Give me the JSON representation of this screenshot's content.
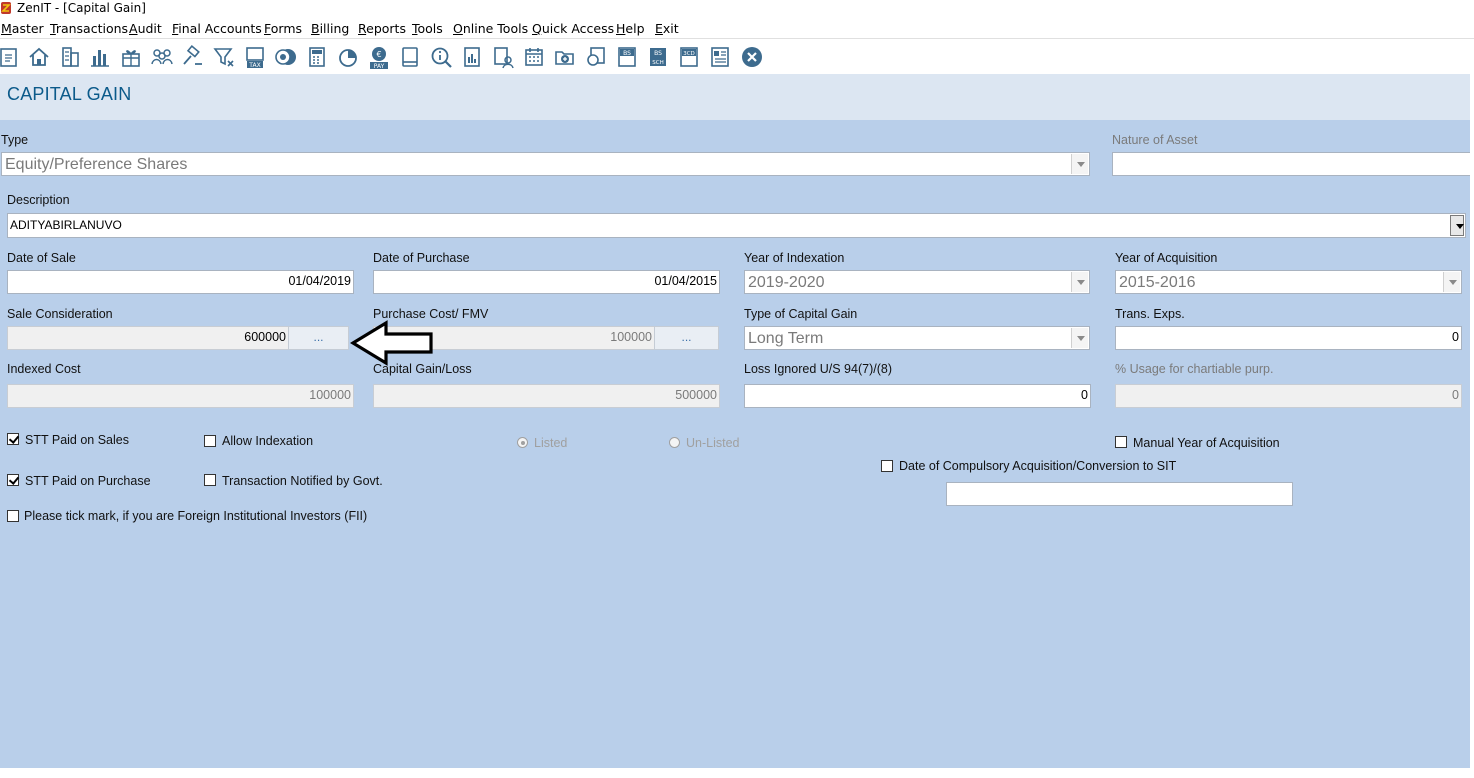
{
  "window": {
    "title": "ZenIT - [Capital Gain]"
  },
  "menu": [
    {
      "label": "Master",
      "key": "M",
      "rest": "aster"
    },
    {
      "label": "Transactions",
      "key": "T",
      "rest": "ransactions"
    },
    {
      "label": "Audit",
      "key": "A",
      "rest": "udit"
    },
    {
      "label": "Final Accounts",
      "key": "F",
      "rest": "inal Accounts"
    },
    {
      "label": "Forms",
      "key": "F",
      "rest": "orms"
    },
    {
      "label": "Billing",
      "key": "B",
      "rest": "illing"
    },
    {
      "label": "Reports",
      "key": "R",
      "rest": "eports"
    },
    {
      "label": "Tools",
      "key": "T",
      "rest": "ools"
    },
    {
      "label": "Online Tools",
      "key": "O",
      "rest": "nline Tools"
    },
    {
      "label": "Quick Access",
      "key": "Q",
      "rest": "uick Access"
    },
    {
      "label": "Help",
      "key": "H",
      "rest": "elp"
    },
    {
      "label": "Exit",
      "key": "E",
      "rest": "xit"
    }
  ],
  "toolbar_icons": [
    "refresh-icon",
    "home-icon",
    "building-icon",
    "bar-chart-icon",
    "gift-icon",
    "group-icon",
    "gavel-icon",
    "filter-icon",
    "tax-icon",
    "coins-icon",
    "calculator-icon",
    "pie-chart-icon",
    "pay-icon",
    "book-icon",
    "search-info-icon",
    "report-icon",
    "user-report-icon",
    "calendar-icon",
    "add-folder-icon",
    "copy-search-icon",
    "bs-icon",
    "bs-sch-icon",
    "3cd-icon",
    "form-icon",
    "close-circle-icon"
  ],
  "toolbar_text": {
    "tax": "TAX",
    "pay": "PAY",
    "bs": "BS",
    "bs2": "BS",
    "sch": "SCH",
    "cd": "3CD"
  },
  "page": {
    "title": "CAPITAL GAIN"
  },
  "form": {
    "type": {
      "label": "Type",
      "value": "Equity/Preference Shares"
    },
    "nature_of_asset": {
      "label": "Nature of Asset",
      "value": ""
    },
    "description": {
      "label": "Description",
      "value": "ADITYABIRLANUVO"
    },
    "date_of_sale": {
      "label": "Date of Sale",
      "value": "01/04/2019"
    },
    "date_of_purchase": {
      "label": "Date of Purchase",
      "value": "01/04/2015"
    },
    "year_of_indexation": {
      "label": "Year of Indexation",
      "value": "2019-2020"
    },
    "year_of_acquisition": {
      "label": "Year of Acquisition",
      "value": "2015-2016"
    },
    "sale_consideration": {
      "label": "Sale Consideration",
      "value": "600000",
      "button": "..."
    },
    "purchase_cost": {
      "label": "Purchase Cost/ FMV",
      "value": "100000",
      "button": "..."
    },
    "type_of_capital_gain": {
      "label": "Type of Capital Gain",
      "value": "Long Term"
    },
    "trans_exps": {
      "label": "Trans. Exps.",
      "value": "0"
    },
    "indexed_cost": {
      "label": "Indexed Cost",
      "value": "100000"
    },
    "capital_gain_loss": {
      "label": "Capital Gain/Loss",
      "value": "500000"
    },
    "loss_ignored": {
      "label": "Loss Ignored U/S 94(7)/(8)",
      "value": "0"
    },
    "usage_charitable": {
      "label": "% Usage for chartiable  purp.",
      "value": "0"
    }
  },
  "options": {
    "stt_paid_sales": {
      "label": "STT Paid on Sales",
      "checked": true
    },
    "allow_indexation": {
      "label": "Allow Indexation",
      "checked": false
    },
    "listed": {
      "label": "Listed",
      "selected": true
    },
    "unlisted": {
      "label": "Un-Listed",
      "selected": false
    },
    "manual_year": {
      "label": "Manual Year of Acquisition",
      "checked": false
    },
    "compulsory_acq": {
      "label": "Date of Compulsory Acquisition/Conversion to SIT",
      "checked": false,
      "value": ""
    },
    "stt_paid_purchase": {
      "label": "STT Paid on Purchase",
      "checked": true
    },
    "notified_by_govt": {
      "label": "Transaction Notified by Govt.",
      "checked": false
    },
    "fii": {
      "label": "Please tick mark, if you are Foreign Institutional Investors (FII)",
      "checked": false
    }
  }
}
